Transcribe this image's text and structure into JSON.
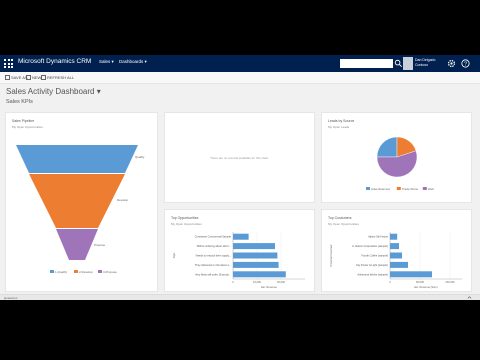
{
  "app": {
    "title": "Microsoft Dynamics CRM",
    "nav_links": [
      "Sales",
      "Dashboards"
    ],
    "user": {
      "name": "Dan Delgado",
      "org": "Contoso"
    }
  },
  "commands": [
    "SAVE AS",
    "NEW",
    "REFRESH ALL"
  ],
  "dashboard": {
    "title": "Sales Activity Dashboard",
    "section": "Sales KPIs"
  },
  "colors": {
    "nav": "#002050",
    "blue": "#5b9bd5",
    "orange": "#ed7d31",
    "purple": "#a074b9",
    "page": "#f1f1f1"
  },
  "tiles": {
    "funnel": {
      "title": "Sales Pipeline",
      "subtitle": "My Open Opportunities"
    },
    "empty": {
      "message": "There are no records available for this chart."
    },
    "pie": {
      "title": "Leads by Source",
      "subtitle": "My Open Leads"
    },
    "opps": {
      "title": "Top Opportunities",
      "subtitle": "My Open Opportunities"
    },
    "customers": {
      "title": "Top Customers",
      "subtitle": "My Open Opportunities"
    }
  },
  "chart_data": [
    {
      "type": "funnel",
      "title": "Sales Pipeline",
      "stages": [
        {
          "name": "Qualify",
          "label": "Qualify",
          "value": 28
        },
        {
          "name": "Develop",
          "label": "Develop",
          "value": 24
        },
        {
          "name": "Propose",
          "label": "Propose",
          "value": 11
        }
      ],
      "legend": [
        "1-Qualify",
        "2-Develop",
        "3-Propose"
      ],
      "legend_placement": "bottom"
    },
    {
      "type": "pie",
      "title": "Leads by Source",
      "slices": [
        {
          "name": "Advertisement",
          "value": 25
        },
        {
          "name": "Trade Show",
          "value": 20
        },
        {
          "name": "Web",
          "value": 55
        }
      ],
      "legend_placement": "bottom"
    },
    {
      "type": "bar",
      "orientation": "horizontal",
      "title": "Top Opportunities",
      "ylabel": "Topic",
      "xlabel": "Est. Revenue",
      "categories": [
        "Consistent Commercial Sample",
        "Will be ordering about 110 it...",
        "Needs to restock their supply...",
        "They delivered on the latest a...",
        "Very likely will order 18 produ..."
      ],
      "values": [
        6500,
        17500,
        18500,
        19000,
        22000
      ],
      "xlim": [
        0,
        30000
      ],
      "ticks": [
        "0",
        "10,000",
        "20,000"
      ],
      "gridlines": true
    },
    {
      "type": "bar",
      "orientation": "horizontal",
      "title": "Top Customers",
      "ylabel": "Potential Customer",
      "xlabel": "Est. Revenue (Sum)",
      "categories": [
        "Alpine Ski House",
        "A. Datum Corporation (sample)",
        "Fourth Coffee (sample)",
        "City Power & Light (sample)",
        "Adventure Works (sample)"
      ],
      "values": [
        12000,
        15000,
        20000,
        30000,
        70000
      ],
      "xlim": [
        0,
        120000
      ],
      "ticks": [
        "0",
        "50,000",
        "100,000"
      ],
      "gridlines": true
    }
  ],
  "footer": {
    "text": "javascript:;"
  }
}
